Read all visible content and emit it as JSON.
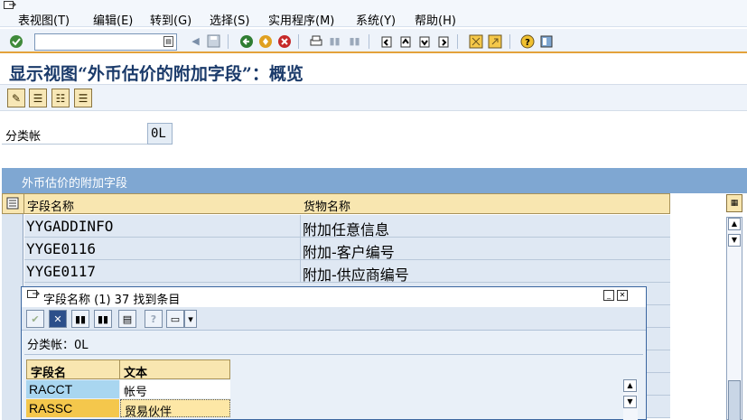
{
  "menu": {
    "items": [
      "表视图(T)",
      "编辑(E)",
      "转到(G)",
      "选择(S)",
      "实用程序(M)",
      "系统(Y)",
      "帮助(H)"
    ]
  },
  "toolbar": {
    "command_value": "",
    "icons": [
      "enter-icon",
      "save-icon",
      "back-icon",
      "exit-icon",
      "cancel-icon",
      "print-icon",
      "find-icon",
      "find-next-icon",
      "first-page-icon",
      "previous-page-icon",
      "next-page-icon",
      "last-page-icon",
      "new-session-icon",
      "shortcut-icon",
      "help-icon",
      "layout-icon"
    ]
  },
  "page": {
    "title": "显示视图“外币估价的附加字段”：概览"
  },
  "selection": {
    "label": "分类帐",
    "value": "0L"
  },
  "panel": {
    "title": "外币估价的附加字段"
  },
  "table": {
    "columns": [
      "字段名称",
      "货物名称"
    ],
    "rows": [
      [
        "YYGADDINFO",
        "附加任意信息"
      ],
      [
        "YYGE0116",
        "附加-客户编号"
      ],
      [
        "YYGE0117",
        "附加-供应商编号"
      ]
    ]
  },
  "popup": {
    "title": "字段名称 (1)   37 找到条目",
    "filter_text": "分类帐：0L",
    "columns": [
      "字段名",
      "文本"
    ],
    "rows": [
      [
        "RACCT",
        "帐号"
      ],
      [
        "RASSC",
        "贸易伙伴"
      ]
    ]
  },
  "colors": {
    "accent": "#e3a23b",
    "panel_header": "#7fa7d2",
    "row_bg": "#dfe8f3",
    "popup_key_bg": "#a9d6f0",
    "popup_selected_bg": "#f4c74c"
  }
}
